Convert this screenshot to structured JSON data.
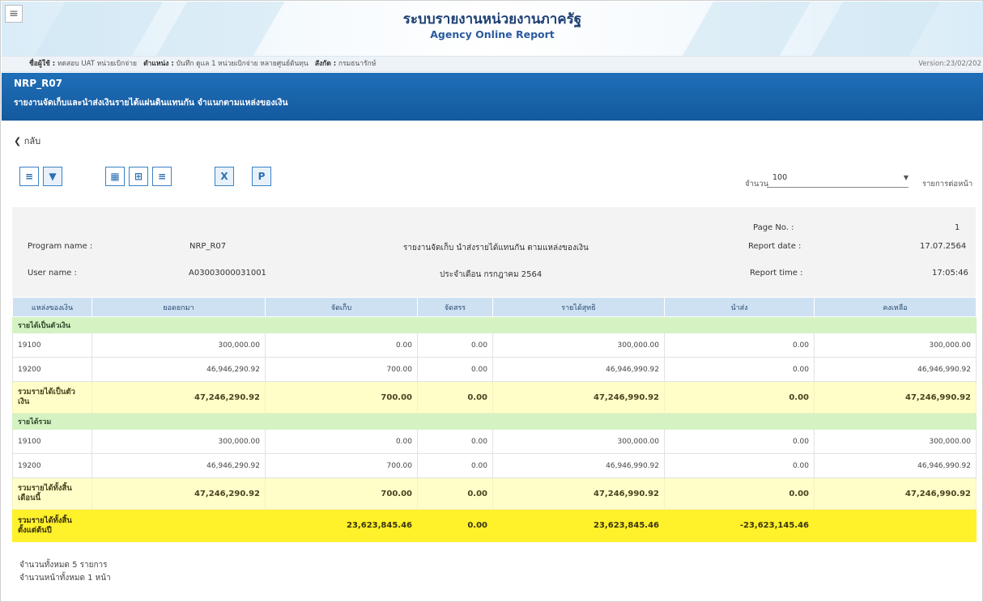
{
  "header": {
    "menu_icon": "hamburger-icon",
    "title_th": "ระบบรายงานหน่วยงานภาครัฐ",
    "title_en": "Agency Online Report"
  },
  "userbar": {
    "user_label": "ชื่อผู้ใช้ :",
    "user_value": "ทดสอบ UAT หน่วยเบิกจ่าย",
    "position_label": "ตำแหน่ง :",
    "position_value": "บันทึก ดูแล 1 หน่วยเบิกจ่าย หลายศูนย์ต้นทุน",
    "org_label": "สังกัด :",
    "org_value": "กรมธนารักษ์",
    "version": "Version:23/02/202"
  },
  "report_bar": {
    "code": "NRP_R07",
    "description": "รายงานจัดเก็บและนำส่งเงินรายได้แผ่นดินแทนกัน จำแนกตามแหล่งของเงิน"
  },
  "back_label": "กลับ",
  "toolbar": {
    "amount_label": "จำนวน",
    "amount_value": "100",
    "amount_suffix": "รายการต่อหน้า"
  },
  "info": {
    "page_no_label": "Page No. :",
    "page_no_value": "1",
    "program_label": "Program name :",
    "program_value": "NRP_R07",
    "report_title": "รายงานจัดเก็บ นำส่งรายได้แทนกัน ตามแหล่งของเงิน",
    "report_date_label": "Report date :",
    "report_date_value": "17.07.2564",
    "user_label": "User name :",
    "user_value": "A03003000031001",
    "period": "ประจำเดือน กรกฎาคม 2564",
    "report_time_label": "Report time :",
    "report_time_value": "17:05:46"
  },
  "table": {
    "headers": [
      "แหล่งของเงิน",
      "ยอดยกมา",
      "จัดเก็บ",
      "จัดสรร",
      "รายได้สุทธิ",
      "นำส่ง",
      "คงเหลือ"
    ],
    "group1": "รายได้เป็นตัวเงิน",
    "g1_rows": [
      [
        "19100",
        "300,000.00",
        "0.00",
        "0.00",
        "300,000.00",
        "0.00",
        "300,000.00"
      ],
      [
        "19200",
        "46,946,290.92",
        "700.00",
        "0.00",
        "46,946,990.92",
        "0.00",
        "46,946,990.92"
      ]
    ],
    "g1_sum": [
      "รวมรายได้เป็นตัวเงิน",
      "47,246,290.92",
      "700.00",
      "0.00",
      "47,246,990.92",
      "0.00",
      "47,246,990.92"
    ],
    "group2": "รายได้รวม",
    "g2_rows": [
      [
        "19100",
        "300,000.00",
        "0.00",
        "0.00",
        "300,000.00",
        "0.00",
        "300,000.00"
      ],
      [
        "19200",
        "46,946,290.92",
        "700.00",
        "0.00",
        "46,946,990.92",
        "0.00",
        "46,946,990.92"
      ]
    ],
    "g2_sum": [
      "รวมรายได้ทั้งสิ้นเดือนนี้",
      "47,246,290.92",
      "700.00",
      "0.00",
      "47,246,990.92",
      "0.00",
      "47,246,990.92"
    ],
    "ytd": [
      "รวมรายได้ทั้งสิ้นตั้งแต่ต้นปี",
      "",
      "23,623,845.46",
      "0.00",
      "23,623,845.46",
      "-23,623,145.46",
      ""
    ]
  },
  "footer": {
    "total_items": "จำนวนทั้งหมด 5 รายการ",
    "total_pages": "จำนวนหน้าทั้งหมด 1 หน้า"
  },
  "colors": {
    "header_blue": "#1f6fb8",
    "group_green": "#d5f2c3",
    "sum_yellow": "#fffec9",
    "ytd_yellow": "#fff12a",
    "table_head": "#cde1f2"
  }
}
